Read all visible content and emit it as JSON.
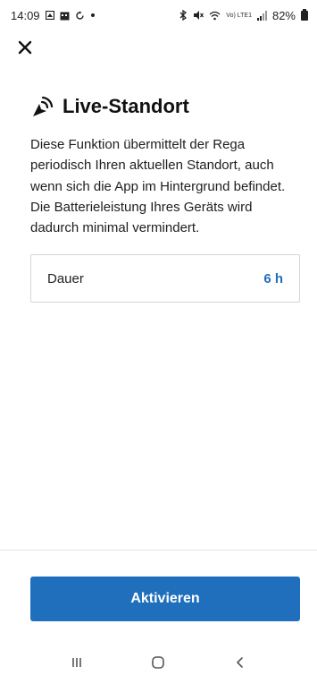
{
  "status_bar": {
    "time": "14:09",
    "battery": "82%",
    "network": "Vo) LTE1",
    "left_icons": [
      "notification-icon",
      "calendar-icon",
      "sync-icon",
      "dot-icon"
    ],
    "right_icons": [
      "bluetooth-icon",
      "mute-icon",
      "wifi-icon",
      "signal-icon",
      "battery-icon"
    ]
  },
  "header": {
    "close_icon": "close-icon"
  },
  "main": {
    "title": "Live-Standort",
    "title_icon": "live-location-icon",
    "description": "Diese Funktion übermittelt der Rega periodisch Ihren aktuellen Standort, auch wenn sich die App im Hintergrund befindet. Die Batterieleistung Ihres Geräts wird dadurch minimal vermindert.",
    "duration": {
      "label": "Dauer",
      "value": "6 h"
    }
  },
  "footer": {
    "activate_label": "Aktivieren"
  },
  "nav_bar": {
    "items": [
      "recents-icon",
      "home-icon",
      "back-icon"
    ]
  },
  "colors": {
    "accent": "#1f6fbd",
    "text": "#1a1a1a",
    "border": "#d6d6d6"
  }
}
